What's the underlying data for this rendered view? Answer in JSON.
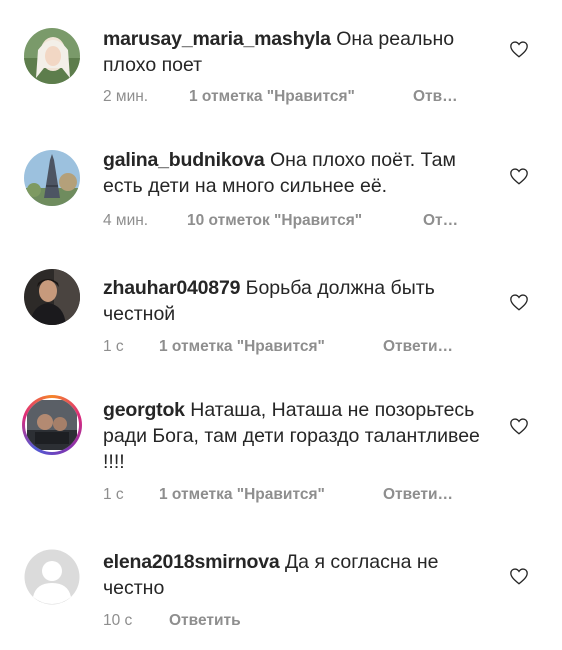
{
  "comments": [
    {
      "username": "marusay_maria_mashyla",
      "text": "Она реально плохо поет",
      "time": "2 мин.",
      "likes": "1 отметка \"Нравится\"",
      "reply": "Отв…"
    },
    {
      "username": "galina_budnikova",
      "text": "Она плохо поёт. Там есть дети на много сильнее её.",
      "time": "4 мин.",
      "likes": "10 отметок \"Нравится\"",
      "reply": "От…"
    },
    {
      "username": "zhauhar040879",
      "text": "Борьба должна быть честной",
      "time": "1 с",
      "likes": "1 отметка \"Нравится\"",
      "reply": "Ответи…"
    },
    {
      "username": "georgtok",
      "text": "Наташа, Наташа не позорьтесь ради Бога, там дети гораздо талантливее !!!!",
      "time": "1 с",
      "likes": "1 отметка \"Нравится\"",
      "reply": "Ответи…"
    },
    {
      "username": "elena2018smirnova",
      "text": "Да я согласна не честно",
      "time": "10 с",
      "reply": "Ответить"
    }
  ],
  "icons": {
    "like": "heart-outline-icon",
    "avatar_placeholder": "default-user-icon"
  },
  "colors": {
    "text": "#262626",
    "secondary": "#8e8e8e",
    "story_ring": "#dd2a7b"
  }
}
